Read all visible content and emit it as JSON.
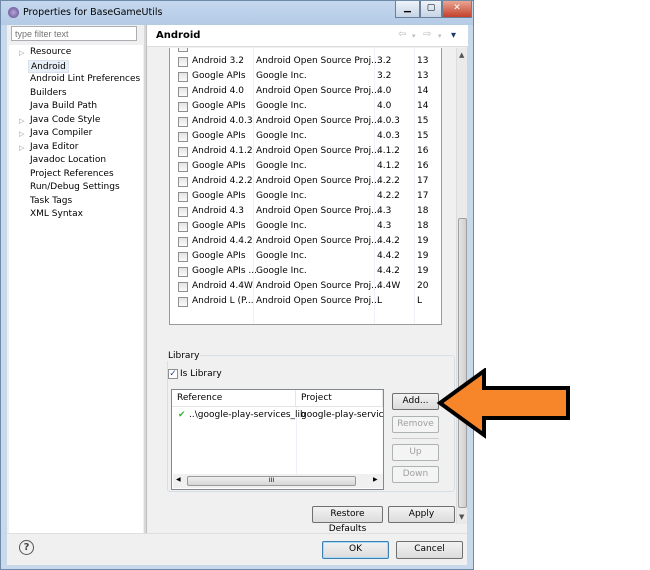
{
  "window": {
    "title": "Properties for BaseGameUtils",
    "minimize": "▁",
    "maximize": "▢",
    "close": "✕"
  },
  "filter": {
    "placeholder": "type filter text"
  },
  "tree": [
    {
      "label": "Resource",
      "expandable": true
    },
    {
      "label": "Android",
      "selected": true
    },
    {
      "label": "Android Lint Preferences"
    },
    {
      "label": "Builders"
    },
    {
      "label": "Java Build Path"
    },
    {
      "label": "Java Code Style",
      "expandable": true
    },
    {
      "label": "Java Compiler",
      "expandable": true
    },
    {
      "label": "Java Editor",
      "expandable": true
    },
    {
      "label": "Javadoc Location"
    },
    {
      "label": "Project References"
    },
    {
      "label": "Run/Debug Settings"
    },
    {
      "label": "Task Tags"
    },
    {
      "label": "XML Syntax"
    }
  ],
  "page": {
    "title": "Android",
    "nav": {
      "back": "⇦",
      "fwd": "⇨",
      "menu": "▾"
    }
  },
  "targets": [
    [
      "Android 3.2",
      "Android Open Source Proj...",
      "3.2",
      "13"
    ],
    [
      "Google APIs",
      "Google Inc.",
      "3.2",
      "13"
    ],
    [
      "Android 4.0",
      "Android Open Source Proj...",
      "4.0",
      "14"
    ],
    [
      "Google APIs",
      "Google Inc.",
      "4.0",
      "14"
    ],
    [
      "Android 4.0.3",
      "Android Open Source Proj...",
      "4.0.3",
      "15"
    ],
    [
      "Google APIs",
      "Google Inc.",
      "4.0.3",
      "15"
    ],
    [
      "Android 4.1.2",
      "Android Open Source Proj...",
      "4.1.2",
      "16"
    ],
    [
      "Google APIs",
      "Google Inc.",
      "4.1.2",
      "16"
    ],
    [
      "Android 4.2.2",
      "Android Open Source Proj...",
      "4.2.2",
      "17"
    ],
    [
      "Google APIs",
      "Google Inc.",
      "4.2.2",
      "17"
    ],
    [
      "Android 4.3",
      "Android Open Source Proj...",
      "4.3",
      "18"
    ],
    [
      "Google APIs",
      "Google Inc.",
      "4.3",
      "18"
    ],
    [
      "Android 4.4.2",
      "Android Open Source Proj...",
      "4.4.2",
      "19"
    ],
    [
      "Google APIs",
      "Google Inc.",
      "4.4.2",
      "19"
    ],
    [
      "Google APIs ...",
      "Google Inc.",
      "4.4.2",
      "19"
    ],
    [
      "Android 4.4W",
      "Android Open Source Proj...",
      "4.4W",
      "20"
    ],
    [
      "Android L (P...",
      "Android Open Source Proj...",
      "L",
      "L"
    ]
  ],
  "library": {
    "group_label": "Library",
    "is_library_label": "Is Library",
    "is_library_checked": true,
    "columns": [
      "Reference",
      "Project"
    ],
    "rows": [
      {
        "reference": "..\\google-play-services_lib",
        "project": "google-play-services",
        "status": "ok"
      }
    ],
    "hscroll_grip": "III",
    "buttons": {
      "add": "Add...",
      "remove": "Remove",
      "up": "Up",
      "down": "Down"
    }
  },
  "actions": {
    "restore": "Restore Defaults",
    "apply": "Apply",
    "ok": "OK",
    "cancel": "Cancel",
    "help": "?"
  },
  "annotation": {
    "arrow_color": "#f7862a",
    "outline_color": "#000000"
  }
}
